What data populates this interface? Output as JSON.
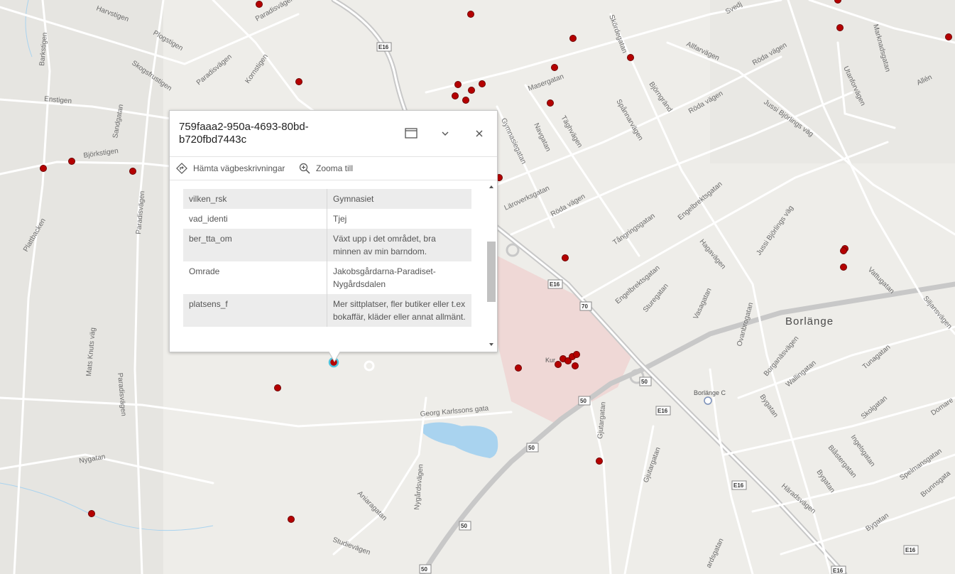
{
  "popup": {
    "title": "759faaa2-950a-4693-80bd-b720fbd7443c",
    "actions": {
      "directions": "Hämta vägbeskrivningar",
      "zoom": "Zooma till"
    },
    "rows": [
      {
        "key": "vilken_rsk",
        "value": "Gymnasiet"
      },
      {
        "key": "vad_identi",
        "value": "Tjej"
      },
      {
        "key": "ber_tta_om",
        "value": "Växt upp i det området, bra minnen av min barndom."
      },
      {
        "key": "Omrade",
        "value": "Jakobsgårdarna-Paradiset-Nygårdsdalen"
      },
      {
        "key": "platsens_f",
        "value": "Mer sittplatser, fler butiker eller t.ex bokaffär, kläder eller annat allmänt."
      }
    ]
  },
  "map": {
    "city": "Borlänge",
    "station": "Borlänge C",
    "mall_label": "Kur",
    "streets": {
      "harvstigen": "Harvstigen",
      "plogstigen": "Plogstigen",
      "paradisvagen": "Paradisvägen",
      "barkstigen": "Barkstigen",
      "skogsfrustigen": "Skogsfrustigen",
      "kornstigen": "Kornstigen",
      "enstigen": "Enstigen",
      "sandgatan": "Sandgatan",
      "bjorkstigen": "Björkstigen",
      "plattbacken": "Plattbacken",
      "mats_knuts": "Mats Knuts väg",
      "nygatan": "Nygatan",
      "studievagen": "Studievägen",
      "aniaragatan": "Aniaragatan",
      "nygardsvagen": "Nygårdsvägen",
      "georg": "Georg Karlssons gata",
      "roda_vagen": "Röda vägen",
      "laroverksgatan": "Läroverksgatan",
      "gymnasiegatan": "Gymnasiegatan",
      "navgatan": "Navgatan",
      "taghagen": "Täghvägen",
      "masergatan": "Masergatan",
      "skordegatan": "Skördegatan",
      "spannarvagen": "Spånnarvägen",
      "bjorngrand": "Björngränd",
      "allfarvagen": "Allfarvägen",
      "jussi1": "Jussi Björlings väg",
      "jussi2": "Jussi Björlings väg",
      "utanforvagen": "Utanforvägen",
      "marknadsgatan": "Marknadsgatan",
      "allen": "Allén",
      "svedj": "Svedj",
      "tangringsgatan": "Tångringsgatan",
      "engelbrektsgatan": "Engelbrektsgatan",
      "engelbrektsgatan2": "Engelbrektsgatan",
      "hagavagen": "Hagavägen",
      "sturegatan": "Sturegatan",
      "vasagatan": "Vasagatan",
      "ovanbrogatan": "Ovanbrogatan",
      "vattugatan": "Vattugatan",
      "siljansvagen": "Siljansvägen",
      "borganasvagen": "Borganäsvägen",
      "wallingatan": "Wallingatan",
      "tunagatan": "Tunagatan",
      "skolgatan": "Skolgatan",
      "domarev": "Domare",
      "bygatan": "Bygatan",
      "bygatan2": "Bygatan",
      "bygatan3": "Bygatan",
      "ingelsgatan": "Ingelsgatan",
      "blastergatan": "Blåstergatan",
      "spelmansgatan": "Spelmansgatan",
      "brunnsgatan": "Brunnsgata",
      "haradsvagen": "Häradsvägen",
      "gjutargatan": "Gjutargatan",
      "gjutargatan2": "Gjutargatan",
      "paradisvagen2": "Paradisvägen",
      "paradisvagen3": "Paradisvägen",
      "paradisvagen4": "Paradisvägen",
      "ardsgatan": "ardsgatan"
    },
    "shields": {
      "e16": "E16",
      "r70": "70",
      "r50": "50"
    },
    "colors": {
      "background": "#eeede9",
      "road": "#ffffff",
      "highway": "#c8c8c8",
      "point": "#b50000",
      "water": "#a9d3ef",
      "mall": "#efd8d6"
    }
  }
}
